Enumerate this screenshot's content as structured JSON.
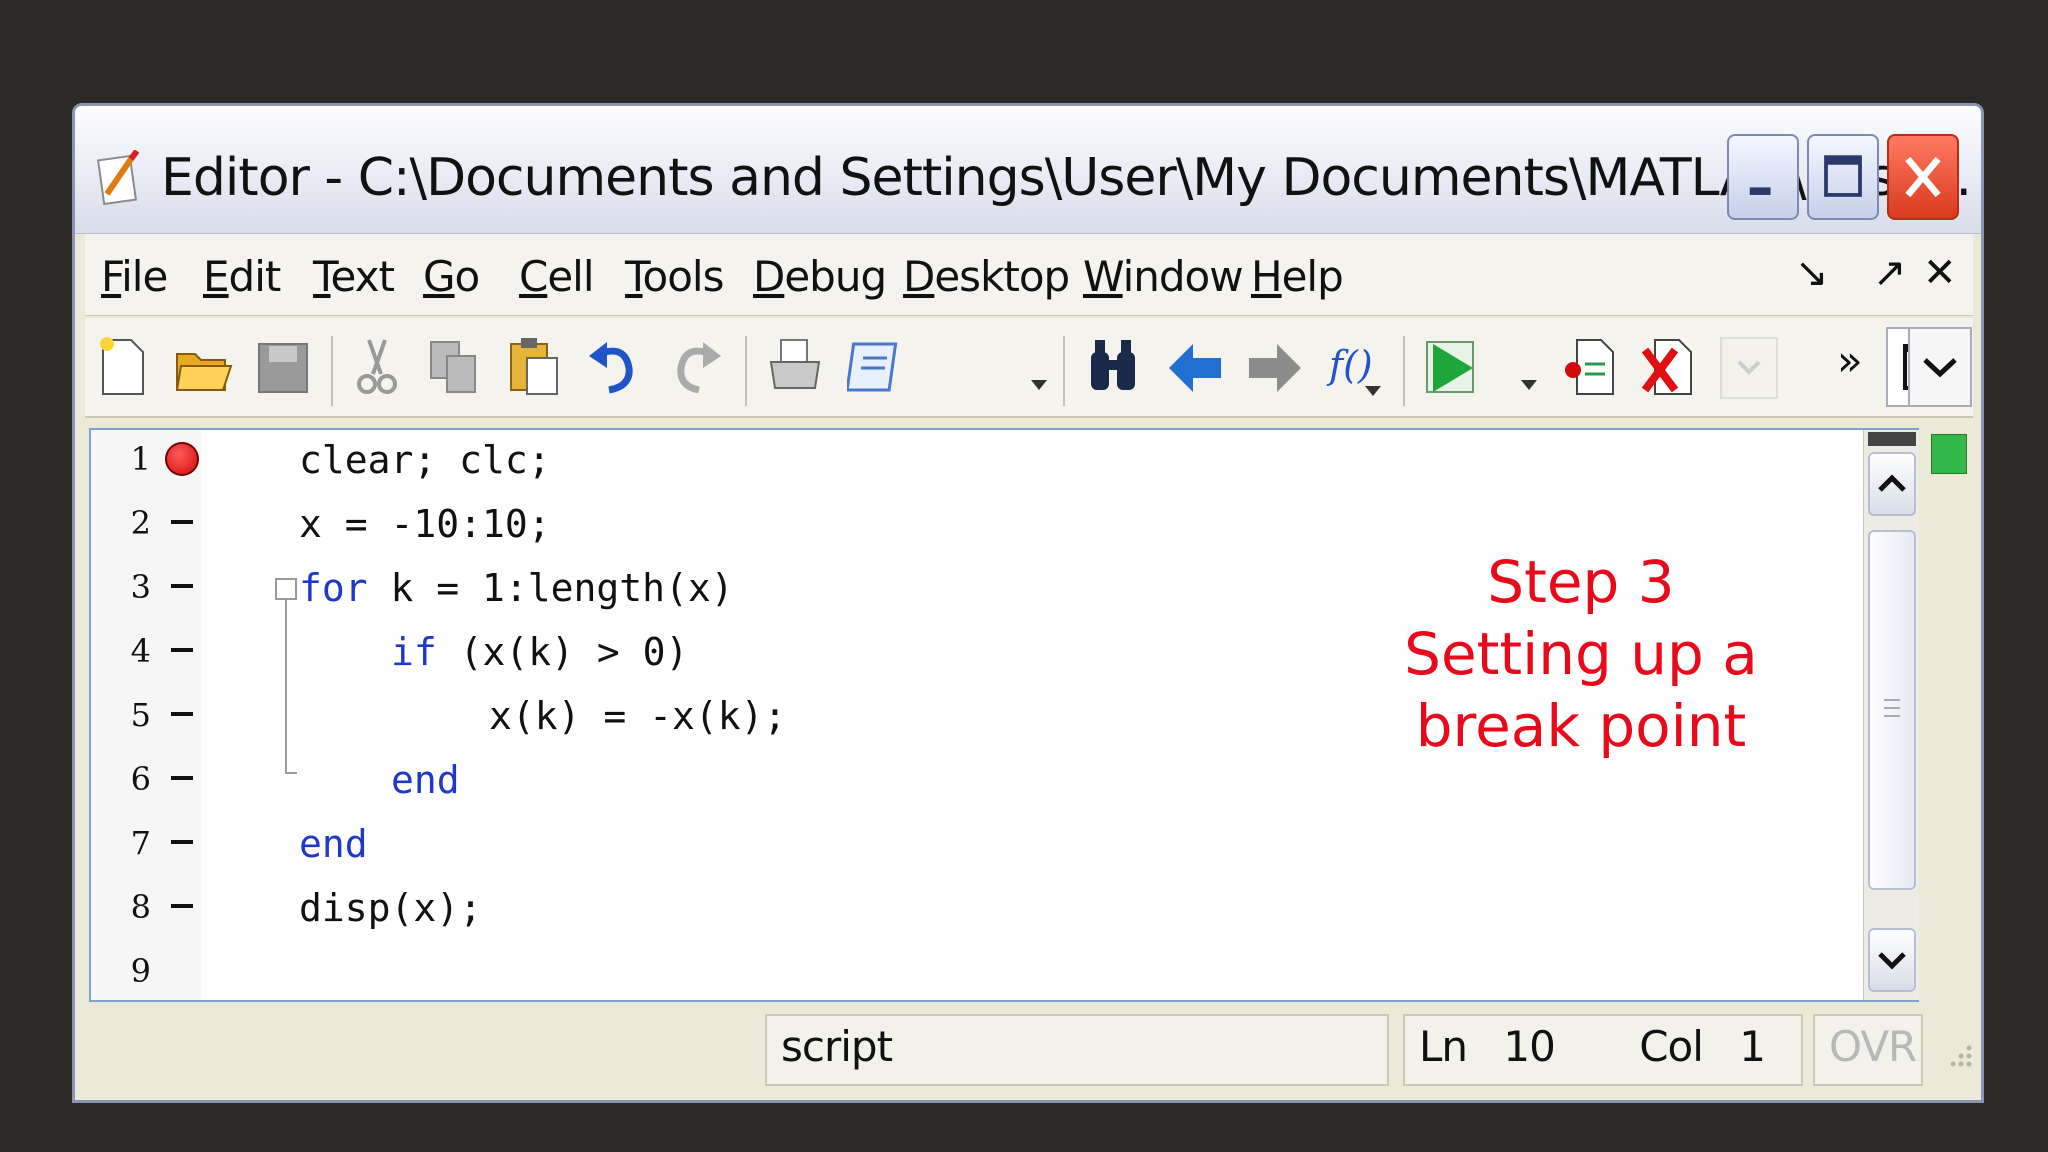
{
  "window": {
    "title": "Editor - C:\\Documents and Settings\\User\\My Documents\\MATLAB\\abso..."
  },
  "menubar": {
    "items": [
      "File",
      "Edit",
      "Text",
      "Go",
      "Cell",
      "Tools",
      "Debug",
      "Desktop",
      "Window",
      "Help"
    ],
    "undock_glyph": "↘",
    "dock_glyph": "↗",
    "close_glyph": "✕"
  },
  "toolbar": {
    "overflow_glyph": "»",
    "icons": [
      "new-file-icon",
      "open-folder-icon",
      "save-icon",
      "cut-icon",
      "copy-icon",
      "paste-icon",
      "undo-icon",
      "redo-icon",
      "print-icon",
      "publish-icon",
      "find-icon",
      "back-icon",
      "forward-icon",
      "function-icon",
      "run-icon",
      "set-breakpoint-icon",
      "clear-breakpoints-icon",
      "stack-icon",
      "dock-window-icon",
      "dropdown-icon"
    ]
  },
  "editor": {
    "lines": [
      {
        "num": "1",
        "marker": "breakpoint",
        "indent": 0,
        "code": "clear; clc;"
      },
      {
        "num": "2",
        "marker": "dash",
        "indent": 0,
        "code": "x = -10:10;"
      },
      {
        "num": "3",
        "marker": "dash",
        "indent": 0,
        "keyword": "for",
        "code": " k = 1:length(x)"
      },
      {
        "num": "4",
        "marker": "dash",
        "indent": 1,
        "keyword": "if",
        "code": " (x(k) > 0)"
      },
      {
        "num": "5",
        "marker": "dash",
        "indent": 2,
        "code": "x(k) = -x(k);"
      },
      {
        "num": "6",
        "marker": "dash",
        "indent": 1,
        "keyword": "end",
        "code": ""
      },
      {
        "num": "7",
        "marker": "dash",
        "indent": 0,
        "keyword": "end",
        "code": ""
      },
      {
        "num": "8",
        "marker": "dash",
        "indent": 0,
        "code": "disp(x);"
      },
      {
        "num": "9",
        "marker": "none",
        "indent": 0,
        "code": ""
      }
    ]
  },
  "annotation": {
    "line1": "Step 3",
    "line2": "Setting up a",
    "line3": "break point",
    "color": "#e8091a"
  },
  "statusbar": {
    "mode": "script",
    "ln_label": "Ln",
    "ln_value": "10",
    "col_label": "Col",
    "col_value": "1",
    "ovr": "OVR"
  },
  "colors": {
    "keyword": "#1f38c9",
    "breakpoint": "#d10b0b",
    "background": "#2b2a26"
  }
}
